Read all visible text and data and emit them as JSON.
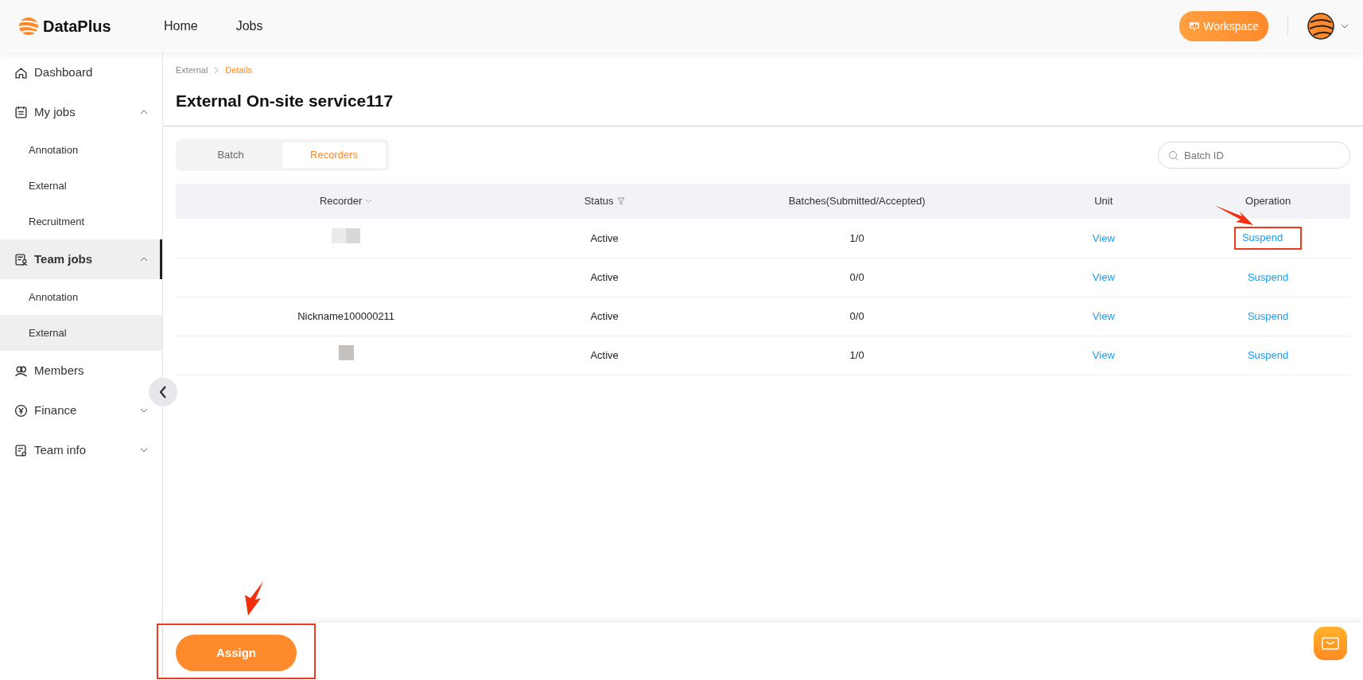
{
  "header": {
    "brand": "DataPlus",
    "nav": [
      {
        "label": "Home"
      },
      {
        "label": "Jobs"
      }
    ],
    "workspace_button": "Workspace"
  },
  "sidebar": {
    "items": [
      {
        "label": "Dashboard",
        "active": false
      },
      {
        "label": "My jobs",
        "expanded": true,
        "active": false,
        "children": [
          {
            "label": "Annotation",
            "selected": false
          },
          {
            "label": "External",
            "selected": false
          },
          {
            "label": "Recruitment",
            "selected": false
          }
        ]
      },
      {
        "label": "Team jobs",
        "expanded": true,
        "active": true,
        "children": [
          {
            "label": "Annotation",
            "selected": false
          },
          {
            "label": "External",
            "selected": true
          }
        ]
      },
      {
        "label": "Members",
        "active": false
      },
      {
        "label": "Finance",
        "expanded": false,
        "active": false
      },
      {
        "label": "Team info",
        "expanded": false,
        "active": false
      }
    ]
  },
  "breadcrumb": [
    {
      "label": "External",
      "selected": false
    },
    {
      "label": "Details",
      "selected": true
    }
  ],
  "title": "External On-site service117",
  "tabs": [
    {
      "label": "Batch",
      "selected": false
    },
    {
      "label": "Recorders",
      "selected": true
    }
  ],
  "search": {
    "placeholder": "Batch ID"
  },
  "table": {
    "columns": [
      {
        "label": "Recorder"
      },
      {
        "label": "Status"
      },
      {
        "label": "Batches(Submitted/Accepted)"
      },
      {
        "label": "Unit"
      },
      {
        "label": "Operation"
      }
    ],
    "rows": [
      {
        "kind": "redacted",
        "status": "Active",
        "batches": "1/0",
        "unit": "View",
        "operation": "Suspend",
        "marked": true
      },
      {
        "kind": "empty",
        "status": "Active",
        "batches": "0/0",
        "unit": "View",
        "operation": "Suspend",
        "marked": false
      },
      {
        "kind": "text",
        "recorder": "Nickname100000211",
        "status": "Active",
        "batches": "0/0",
        "unit": "View",
        "operation": "Suspend",
        "marked": false
      },
      {
        "kind": "redacted_small",
        "status": "Active",
        "batches": "1/0",
        "unit": "View",
        "operation": "Suspend",
        "marked": false
      }
    ]
  },
  "footer": {
    "button": "Assign",
    "marked": true
  }
}
